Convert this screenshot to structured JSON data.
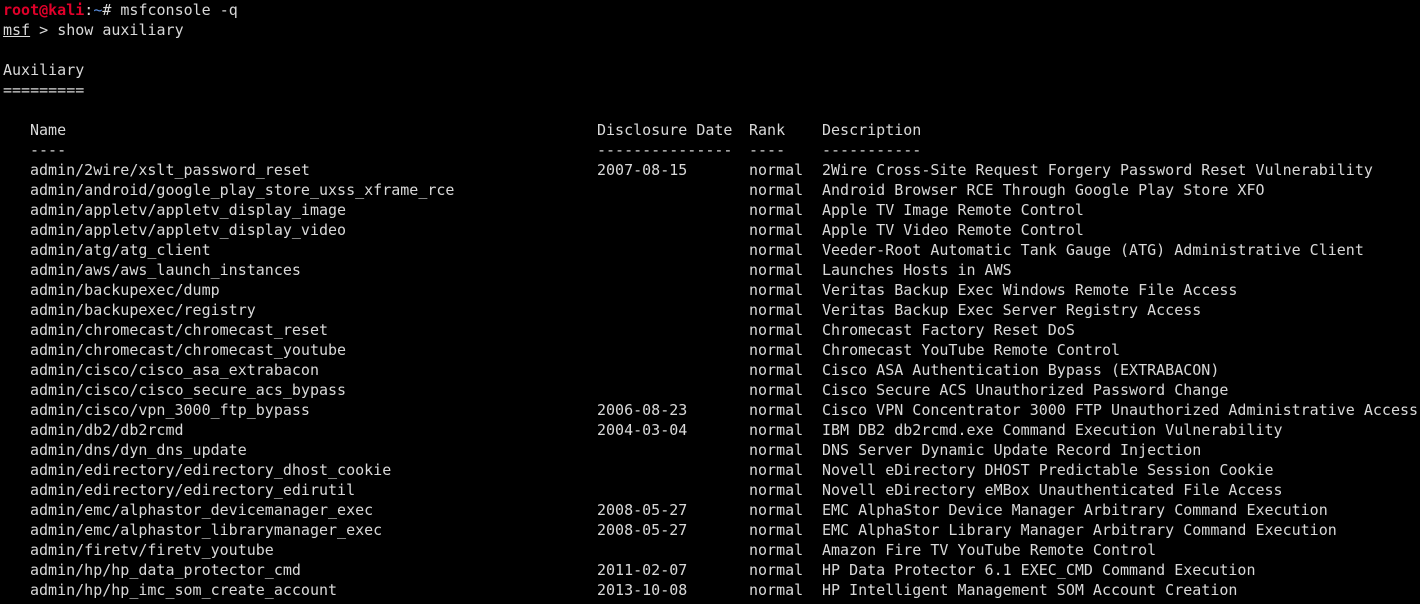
{
  "prompt": {
    "user_host": "root@kali",
    "sep": ":",
    "path": "~",
    "symbol": "# ",
    "command": "msfconsole -q"
  },
  "msf_prompt": {
    "label": "msf",
    "arrow": " > ",
    "command": "show auxiliary"
  },
  "section": {
    "title": "Auxiliary",
    "underline": "========="
  },
  "table": {
    "headers": {
      "name": "Name",
      "date": "Disclosure Date",
      "rank": "Rank",
      "desc": "Description"
    },
    "separators": {
      "name": "----",
      "date": "---------------",
      "rank": "----",
      "desc": "-----------"
    },
    "rows": [
      {
        "name": "admin/2wire/xslt_password_reset",
        "date": "2007-08-15",
        "rank": "normal",
        "desc": "2Wire Cross-Site Request Forgery Password Reset Vulnerability"
      },
      {
        "name": "admin/android/google_play_store_uxss_xframe_rce",
        "date": "",
        "rank": "normal",
        "desc": "Android Browser RCE Through Google Play Store XFO"
      },
      {
        "name": "admin/appletv/appletv_display_image",
        "date": "",
        "rank": "normal",
        "desc": "Apple TV Image Remote Control"
      },
      {
        "name": "admin/appletv/appletv_display_video",
        "date": "",
        "rank": "normal",
        "desc": "Apple TV Video Remote Control"
      },
      {
        "name": "admin/atg/atg_client",
        "date": "",
        "rank": "normal",
        "desc": "Veeder-Root Automatic Tank Gauge (ATG) Administrative Client"
      },
      {
        "name": "admin/aws/aws_launch_instances",
        "date": "",
        "rank": "normal",
        "desc": "Launches Hosts in AWS"
      },
      {
        "name": "admin/backupexec/dump",
        "date": "",
        "rank": "normal",
        "desc": "Veritas Backup Exec Windows Remote File Access"
      },
      {
        "name": "admin/backupexec/registry",
        "date": "",
        "rank": "normal",
        "desc": "Veritas Backup Exec Server Registry Access"
      },
      {
        "name": "admin/chromecast/chromecast_reset",
        "date": "",
        "rank": "normal",
        "desc": "Chromecast Factory Reset DoS"
      },
      {
        "name": "admin/chromecast/chromecast_youtube",
        "date": "",
        "rank": "normal",
        "desc": "Chromecast YouTube Remote Control"
      },
      {
        "name": "admin/cisco/cisco_asa_extrabacon",
        "date": "",
        "rank": "normal",
        "desc": "Cisco ASA Authentication Bypass (EXTRABACON)"
      },
      {
        "name": "admin/cisco/cisco_secure_acs_bypass",
        "date": "",
        "rank": "normal",
        "desc": "Cisco Secure ACS Unauthorized Password Change"
      },
      {
        "name": "admin/cisco/vpn_3000_ftp_bypass",
        "date": "2006-08-23",
        "rank": "normal",
        "desc": "Cisco VPN Concentrator 3000 FTP Unauthorized Administrative Access"
      },
      {
        "name": "admin/db2/db2rcmd",
        "date": "2004-03-04",
        "rank": "normal",
        "desc": "IBM DB2 db2rcmd.exe Command Execution Vulnerability"
      },
      {
        "name": "admin/dns/dyn_dns_update",
        "date": "",
        "rank": "normal",
        "desc": "DNS Server Dynamic Update Record Injection"
      },
      {
        "name": "admin/edirectory/edirectory_dhost_cookie",
        "date": "",
        "rank": "normal",
        "desc": "Novell eDirectory DHOST Predictable Session Cookie"
      },
      {
        "name": "admin/edirectory/edirectory_edirutil",
        "date": "",
        "rank": "normal",
        "desc": "Novell eDirectory eMBox Unauthenticated File Access"
      },
      {
        "name": "admin/emc/alphastor_devicemanager_exec",
        "date": "2008-05-27",
        "rank": "normal",
        "desc": "EMC AlphaStor Device Manager Arbitrary Command Execution"
      },
      {
        "name": "admin/emc/alphastor_librarymanager_exec",
        "date": "2008-05-27",
        "rank": "normal",
        "desc": "EMC AlphaStor Library Manager Arbitrary Command Execution"
      },
      {
        "name": "admin/firetv/firetv_youtube",
        "date": "",
        "rank": "normal",
        "desc": "Amazon Fire TV YouTube Remote Control"
      },
      {
        "name": "admin/hp/hp_data_protector_cmd",
        "date": "2011-02-07",
        "rank": "normal",
        "desc": "HP Data Protector 6.1 EXEC_CMD Command Execution"
      },
      {
        "name": "admin/hp/hp_imc_som_create_account",
        "date": "2013-10-08",
        "rank": "normal",
        "desc": "HP Intelligent Management SOM Account Creation"
      }
    ]
  },
  "colors": {
    "background": "#000000",
    "text": "#d9d9d9",
    "prompt_user": "#e0002a",
    "prompt_path": "#5b8fe0"
  }
}
